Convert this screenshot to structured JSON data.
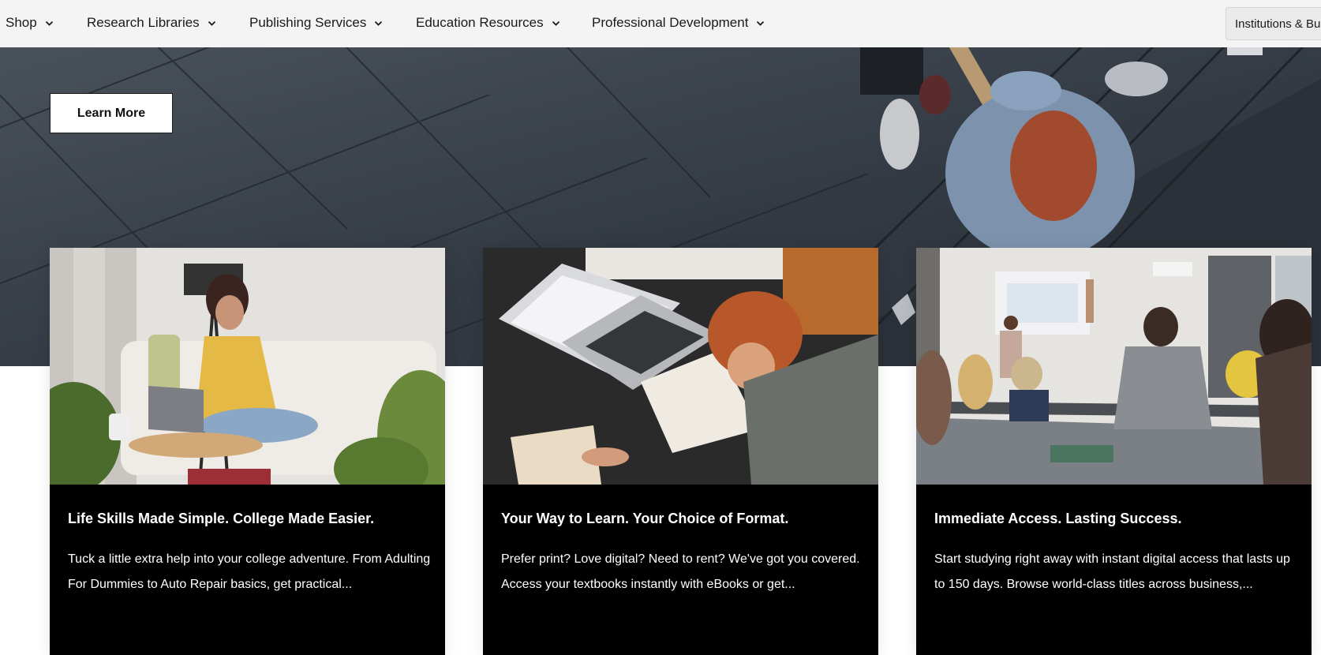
{
  "nav": {
    "items": [
      {
        "label": "Shop"
      },
      {
        "label": "Research Libraries"
      },
      {
        "label": "Publishing Services"
      },
      {
        "label": "Education Resources"
      },
      {
        "label": "Professional Development"
      }
    ],
    "institutions_label": "Institutions & Bu"
  },
  "hero": {
    "learn_more_label": "Learn More"
  },
  "cards": [
    {
      "title": "Life Skills Made Simple. College Made Easier.",
      "description": "Tuck a little extra help into your college adventure. From Adulting For Dummies to Auto Repair basics, get practical..."
    },
    {
      "title": "Your Way to Learn. Your Choice of Format.",
      "description": "Prefer print? Love digital? Need to rent? We've got you covered. Access your textbooks instantly with eBooks or get..."
    },
    {
      "title": "Immediate Access. Lasting Success.",
      "description": "Start studying right away with instant digital access that lasts up to 150 days. Browse world-class titles across business,..."
    }
  ],
  "colors": {
    "nav_bg": "#f4f4f4",
    "card_bg": "#000000",
    "hero_bg": "#3a414a",
    "text_dark": "#1a1a1a",
    "text_light": "#ffffff"
  },
  "icons": {
    "nav_dropdown": "chevron-down-icon"
  }
}
